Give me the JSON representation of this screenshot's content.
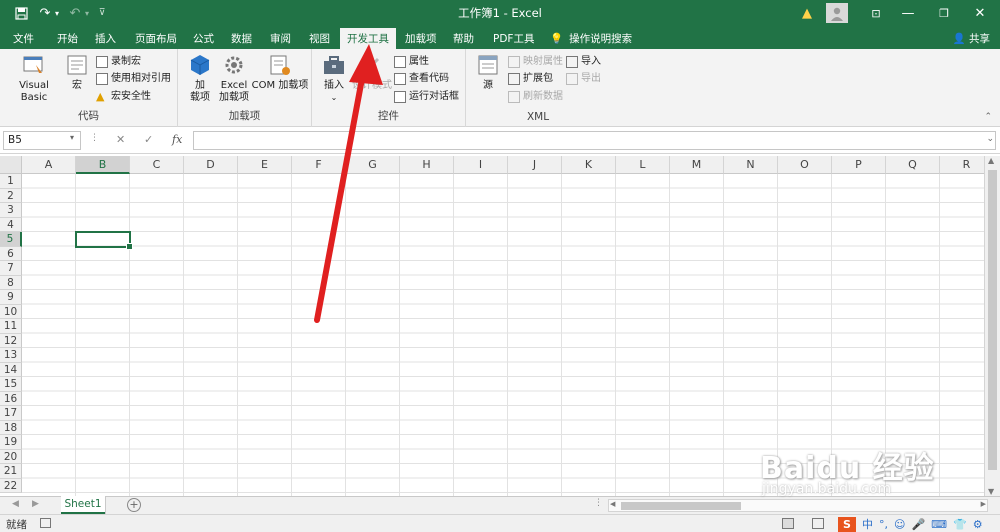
{
  "titlebar": {
    "title": "工作簿1  -  Excel",
    "save_icon": "save-icon",
    "undo_icon": "undo-icon",
    "redo_icon": "redo-icon",
    "warning_icon": "warning-icon",
    "minimize": "—",
    "restore": "❐",
    "close": "✕"
  },
  "tabs": [
    {
      "label": "文件"
    },
    {
      "label": "开始"
    },
    {
      "label": "插入"
    },
    {
      "label": "页面布局"
    },
    {
      "label": "公式"
    },
    {
      "label": "数据"
    },
    {
      "label": "审阅"
    },
    {
      "label": "视图"
    },
    {
      "label": "开发工具",
      "active": true
    },
    {
      "label": "加载项"
    },
    {
      "label": "帮助"
    },
    {
      "label": "PDF工具"
    }
  ],
  "tell_me": "操作说明搜索",
  "share": "共享",
  "ribbon": {
    "code": {
      "label": "代码",
      "visual_basic": "Visual Basic",
      "macro": "宏",
      "record_macro": "录制宏",
      "relative_ref": "使用相对引用",
      "macro_security": "宏安全性"
    },
    "addins": {
      "label": "加载项",
      "addin": "加\n载项",
      "addin_line1": "加",
      "addin_line2": "载项",
      "excel_addin_line1": "Excel",
      "excel_addin_line2": "加载项",
      "com_addin": "COM 加载项"
    },
    "controls": {
      "label": "控件",
      "insert": "插入",
      "design_mode": "设计模式",
      "properties": "属性",
      "view_code": "查看代码",
      "run_dialog": "运行对话框"
    },
    "xml": {
      "label": "XML",
      "source": "源",
      "map_properties": "映射属性",
      "expansion_packs": "扩展包",
      "refresh_data": "刷新数据",
      "import": "导入",
      "export": "导出"
    }
  },
  "formula_bar": {
    "name_box": "B5",
    "cancel": "✕",
    "enter": "✓",
    "fx": "fx",
    "value": ""
  },
  "columns": [
    "A",
    "B",
    "C",
    "D",
    "E",
    "F",
    "G",
    "H",
    "I",
    "J",
    "K",
    "L",
    "M",
    "N",
    "O",
    "P",
    "Q",
    "R"
  ],
  "rows": [
    "1",
    "2",
    "3",
    "4",
    "5",
    "6",
    "7",
    "8",
    "9",
    "10",
    "11",
    "12",
    "13",
    "14",
    "15",
    "16",
    "17",
    "18",
    "19",
    "20",
    "21",
    "22"
  ],
  "selected_cell": {
    "column": "B",
    "row": "5"
  },
  "sheets": [
    {
      "name": "Sheet1",
      "active": true
    }
  ],
  "status": {
    "ready": "就绪",
    "ime_items": [
      "中",
      "°,",
      "☺",
      "🎤",
      "⌨",
      "👕",
      "⚙"
    ]
  },
  "watermark": {
    "brand": "Baidu 经验",
    "url": "jingyan.baidu.com"
  },
  "colors": {
    "accent": "#217346",
    "arrow": "#e02020"
  }
}
